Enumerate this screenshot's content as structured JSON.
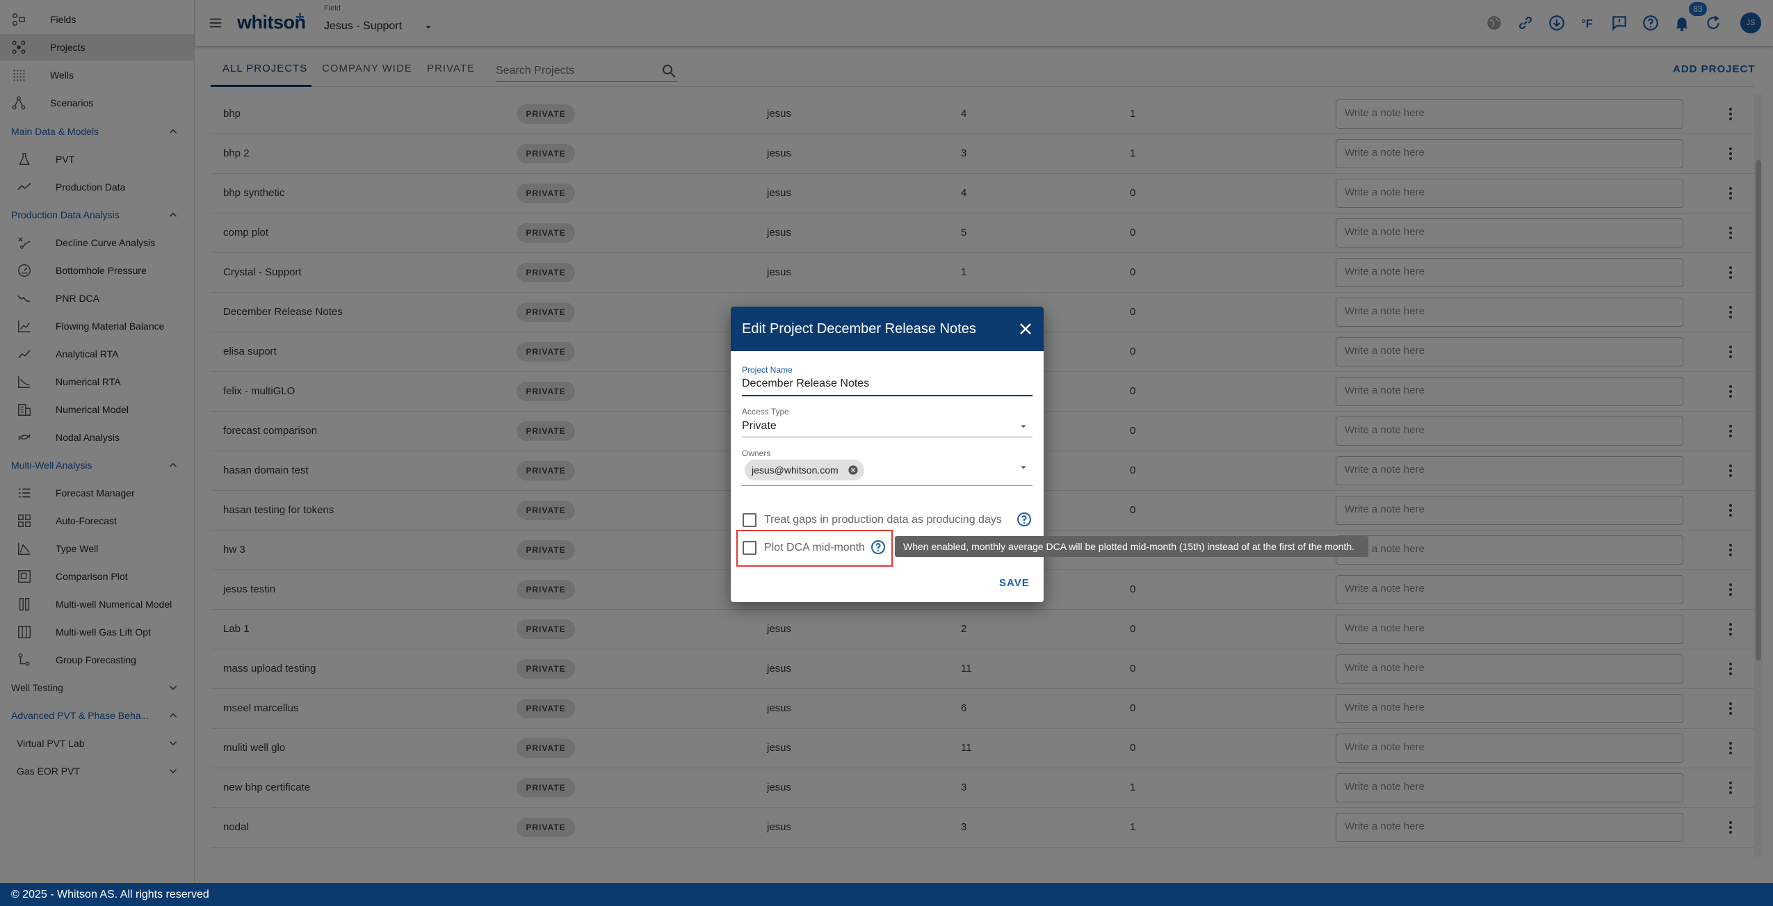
{
  "sidebar": {
    "items": [
      {
        "label": "Fields",
        "icon": "fields-icon"
      },
      {
        "label": "Projects",
        "icon": "projects-icon"
      },
      {
        "label": "Wells",
        "icon": "wells-icon"
      },
      {
        "label": "Scenarios",
        "icon": "scenarios-icon"
      }
    ],
    "sections": [
      {
        "label": "Main Data & Models",
        "expanded": true
      },
      {
        "label": "Production Data Analysis",
        "expanded": true
      },
      {
        "label": "Multi-Well Analysis",
        "expanded": true
      },
      {
        "label": "Well Testing",
        "expanded": false
      },
      {
        "label": "Advanced PVT & Phase Beha...",
        "expanded": true
      }
    ],
    "main_data_items": [
      {
        "label": "PVT",
        "icon": "flask-icon"
      },
      {
        "label": "Production Data",
        "icon": "trend-icon"
      }
    ],
    "pda_items": [
      {
        "label": "Decline Curve Analysis",
        "icon": "decline-icon"
      },
      {
        "label": "Bottomhole Pressure",
        "icon": "gauge-icon"
      },
      {
        "label": "PNR DCA",
        "icon": "pnr-icon"
      },
      {
        "label": "Flowing Material Balance",
        "icon": "chart-icon"
      },
      {
        "label": "Analytical RTA",
        "icon": "line-icon"
      },
      {
        "label": "Numerical RTA",
        "icon": "numerical-rta-icon"
      },
      {
        "label": "Numerical Model",
        "icon": "building-icon"
      },
      {
        "label": "Nodal Analysis",
        "icon": "nodal-icon"
      }
    ],
    "mwa_items": [
      {
        "label": "Forecast Manager",
        "icon": "list-icon"
      },
      {
        "label": "Auto-Forecast",
        "icon": "grid-icon"
      },
      {
        "label": "Type Well",
        "icon": "type-well-icon"
      },
      {
        "label": "Comparison Plot",
        "icon": "comparison-icon"
      },
      {
        "label": "Multi-well Numerical Model",
        "icon": "columns-icon"
      },
      {
        "label": "Multi-well Gas Lift Opt",
        "icon": "gas-lift-icon"
      },
      {
        "label": "Group Forecasting",
        "icon": "group-icon"
      }
    ],
    "pvt_subsections": [
      {
        "label": "Virtual PVT Lab",
        "expanded": false
      },
      {
        "label": "Gas EOR PVT",
        "expanded": false
      }
    ]
  },
  "header": {
    "logo": "whitson",
    "logo_plus": "+",
    "field_caption": "Field",
    "field_value": "Jesus - Support",
    "notification_count": "83",
    "avatar_initials": "JS"
  },
  "tabs": {
    "all_projects": "ALL PROJECTS",
    "company_wide": "COMPANY WIDE",
    "private": "PRIVATE",
    "search_placeholder": "Search Projects",
    "add_project": "ADD PROJECT"
  },
  "table": {
    "note_placeholder": "Write a note here",
    "rows": [
      {
        "name": "bhp",
        "access": "PRIVATE",
        "owner": "jesus",
        "wells": "4",
        "scenarios": "1"
      },
      {
        "name": "bhp 2",
        "access": "PRIVATE",
        "owner": "jesus",
        "wells": "3",
        "scenarios": "1"
      },
      {
        "name": "bhp synthetic",
        "access": "PRIVATE",
        "owner": "jesus",
        "wells": "4",
        "scenarios": "0"
      },
      {
        "name": "comp plot",
        "access": "PRIVATE",
        "owner": "jesus",
        "wells": "5",
        "scenarios": "0"
      },
      {
        "name": "Crystal - Support",
        "access": "PRIVATE",
        "owner": "jesus",
        "wells": "1",
        "scenarios": "0"
      },
      {
        "name": "December Release Notes",
        "access": "PRIVATE",
        "owner": "",
        "wells": "",
        "scenarios": "0"
      },
      {
        "name": "elisa suport",
        "access": "PRIVATE",
        "owner": "",
        "wells": "",
        "scenarios": "0"
      },
      {
        "name": "felix - multiGLO",
        "access": "PRIVATE",
        "owner": "",
        "wells": "",
        "scenarios": "0"
      },
      {
        "name": "forecast comparison",
        "access": "PRIVATE",
        "owner": "",
        "wells": "",
        "scenarios": "0"
      },
      {
        "name": "hasan domain test",
        "access": "PRIVATE",
        "owner": "",
        "wells": "",
        "scenarios": "0"
      },
      {
        "name": "hasan testing for tokens",
        "access": "PRIVATE",
        "owner": "",
        "wells": "",
        "scenarios": "0"
      },
      {
        "name": "hw 3",
        "access": "PRIVATE",
        "owner": "",
        "wells": "",
        "scenarios": ""
      },
      {
        "name": "jesus testin",
        "access": "PRIVATE",
        "owner": "",
        "wells": "",
        "scenarios": "0"
      },
      {
        "name": "Lab 1",
        "access": "PRIVATE",
        "owner": "jesus",
        "wells": "2",
        "scenarios": "0"
      },
      {
        "name": "mass upload testing",
        "access": "PRIVATE",
        "owner": "jesus",
        "wells": "11",
        "scenarios": "0"
      },
      {
        "name": "mseel marcellus",
        "access": "PRIVATE",
        "owner": "jesus",
        "wells": "6",
        "scenarios": "0"
      },
      {
        "name": "muliti well glo",
        "access": "PRIVATE",
        "owner": "jesus",
        "wells": "11",
        "scenarios": "0"
      },
      {
        "name": "new bhp certificate",
        "access": "PRIVATE",
        "owner": "jesus",
        "wells": "3",
        "scenarios": "1"
      },
      {
        "name": "nodal",
        "access": "PRIVATE",
        "owner": "jesus",
        "wells": "3",
        "scenarios": "1"
      }
    ]
  },
  "dialog": {
    "title": "Edit Project December Release Notes",
    "project_name_label": "Project Name",
    "project_name_value": "December Release Notes",
    "access_type_label": "Access Type",
    "access_type_value": "Private",
    "owners_label": "Owners",
    "owner_chip": "jesus@whitson.com",
    "treat_gaps_label": "Treat gaps in production data as producing days",
    "treat_gaps_checked": false,
    "plot_dca_label": "Plot DCA mid-month",
    "plot_dca_checked": false,
    "tooltip": "When enabled, monthly average DCA will be plotted mid-month (15th) instead of at the first of the month.",
    "save_label": "SAVE"
  },
  "footer": {
    "text": "© 2025 - Whitson AS. All rights reserved"
  },
  "colors": {
    "navy": "#0b3a6e",
    "accent_blue": "#1a5ea8",
    "highlight_red": "#e53935"
  }
}
